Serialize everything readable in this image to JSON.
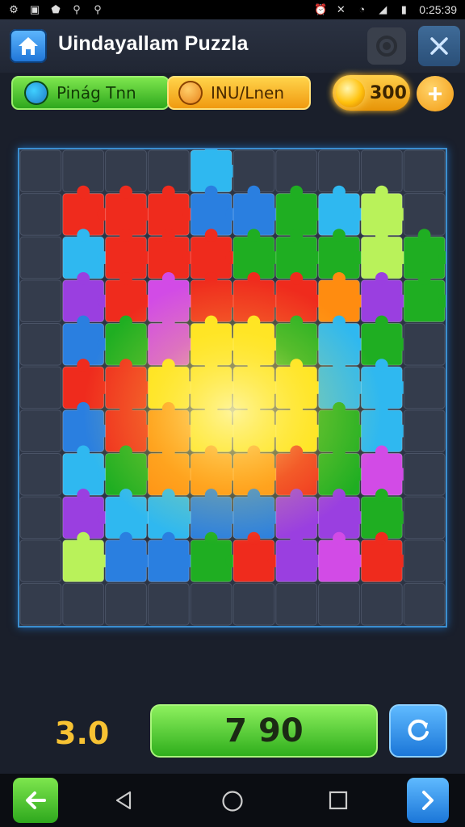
{
  "status_bar": {
    "time": "0:25:39",
    "left_icons": [
      "settings-icon",
      "image-icon",
      "shield-icon",
      "usb-icon",
      "usb-icon"
    ],
    "right_icons": [
      "alarm-icon",
      "mute-icon",
      "wifi-icon",
      "signal-icon",
      "battery-icon"
    ]
  },
  "header": {
    "title": "Uindayallam Puzzla",
    "home_icon": "home-icon",
    "gear_icon": "gear-icon",
    "close_icon": "close-icon"
  },
  "toolbar": {
    "mode_label": "Pinág Tnn",
    "mode_icon": "globe-icon",
    "level_label": "INU/Lnen",
    "level_icon": "coin-icon",
    "coins": "300",
    "plus_label": "+"
  },
  "board": {
    "rows": 11,
    "cols": 10,
    "palette": {
      "R": "#ef2b1d",
      "G": "#1fae22",
      "B": "#2a7fe0",
      "C": "#2fb8f0",
      "Y": "#ffe41a",
      "O": "#ff8c10",
      "P": "#9a3fe0",
      "M": "#d24be6",
      "L": "#b9f25a",
      "E": null
    },
    "grid": [
      "EEEECEEEEE",
      "ERRRBBGCLE",
      "ECRRRGGGLG",
      "EPRMRRROPG",
      "EBGMYYGCGE",
      "ERRYYYYCCE",
      "EBROYYYGCE",
      "ECGOOORGME",
      "EPCCBBPPGE",
      "ELBBGRPMRE",
      "EEEEEEEEEE"
    ]
  },
  "footer": {
    "score": "3.0",
    "main_button": "7 90",
    "refresh_icon": "refresh-icon"
  },
  "navbar": {
    "back_icon": "arrow-left-icon",
    "forward_icon": "arrow-right-icon",
    "nav_icons": [
      "nav-back-icon",
      "nav-home-icon",
      "nav-recents-icon"
    ]
  }
}
